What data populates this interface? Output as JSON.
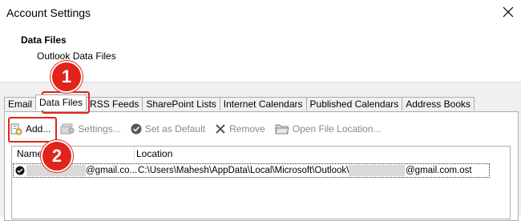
{
  "window": {
    "title": "Account Settings",
    "close_icon": "close-icon"
  },
  "header": {
    "section_title": "Data Files",
    "section_subtitle": "Outlook Data Files"
  },
  "tabs": [
    {
      "label": "Email",
      "active": false
    },
    {
      "label": "Data Files",
      "active": true
    },
    {
      "label": "RSS Feeds",
      "active": false
    },
    {
      "label": "SharePoint Lists",
      "active": false
    },
    {
      "label": "Internet Calendars",
      "active": false
    },
    {
      "label": "Published Calendars",
      "active": false
    },
    {
      "label": "Address Books",
      "active": false
    }
  ],
  "toolbar": {
    "add": {
      "label": "Add...",
      "enabled": true,
      "icon": "add-file-icon"
    },
    "settings": {
      "label": "Settings...",
      "enabled": false,
      "icon": "settings-icon"
    },
    "set_default": {
      "label": "Set as Default",
      "enabled": false,
      "icon": "checkmark-icon"
    },
    "remove": {
      "label": "Remove",
      "enabled": false,
      "icon": "remove-icon"
    },
    "open_location": {
      "label": "Open File Location...",
      "enabled": false,
      "icon": "folder-icon"
    }
  },
  "list": {
    "columns": [
      "Name",
      "Location"
    ],
    "rows": [
      {
        "default": true,
        "name_suffix": "@gmail.co...",
        "location_prefix": "C:\\Users\\Mahesh\\AppData\\Local\\Microsoft\\Outlook\\",
        "location_suffix": "@gmail.com.ost"
      }
    ]
  },
  "annotations": {
    "step1": "1",
    "step2": "2",
    "color": "#e0241a"
  }
}
